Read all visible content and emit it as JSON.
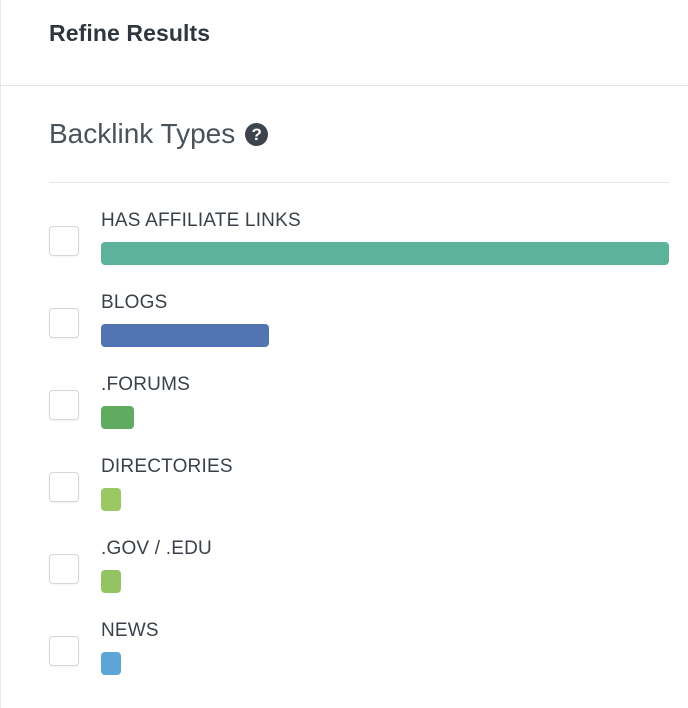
{
  "panel": {
    "title": "Refine Results"
  },
  "section": {
    "title": "Backlink Types",
    "help_icon": "question-circle-icon"
  },
  "filters": [
    {
      "label": "HAS AFFILIATE LINKS",
      "checked": false,
      "color": "#5cb29a",
      "share": 1.0
    },
    {
      "label": "BLOGS",
      "checked": false,
      "color": "#5274b3",
      "share": 0.296
    },
    {
      "label": ".FORUMS",
      "checked": false,
      "color": "#5fac61",
      "share": 0.058
    },
    {
      "label": "DIRECTORIES",
      "checked": false,
      "color": "#9cc864",
      "share": 0.035
    },
    {
      "label": ".GOV / .EDU",
      "checked": false,
      "color": "#94c462",
      "share": 0.035
    },
    {
      "label": "NEWS",
      "checked": false,
      "color": "#5ba6d6",
      "share": 0.035
    }
  ]
}
